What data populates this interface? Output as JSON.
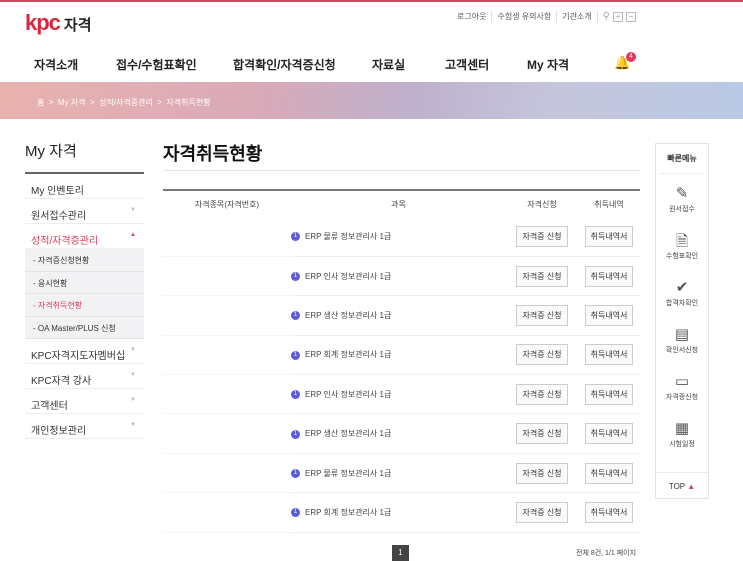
{
  "header": {
    "logo_mark": "kpc",
    "logo_text": "자격",
    "util": [
      "로그아웃",
      "수험생 유의사항",
      "기관소개"
    ],
    "nav": [
      "자격소개",
      "접수/수험표확인",
      "합격확인/자격증신청",
      "자료실",
      "고객센터",
      "My 자격"
    ],
    "notification_count": "4"
  },
  "breadcrumb": "홈  >  My 자격  >  성적/자격증관리  >  자격취득현황",
  "sidebar": {
    "title": "My 자격",
    "items": [
      {
        "label": "My 인벤토리"
      },
      {
        "label": "원서접수관리"
      },
      {
        "label": "성적/자격증관리"
      },
      {
        "label": "KPC자격지도자멤버십"
      },
      {
        "label": "KPC자격 강사"
      },
      {
        "label": "고객센터"
      },
      {
        "label": "개인정보관리"
      }
    ],
    "subitems": [
      "- 자격증신청현황",
      "- 응시현황",
      "- 자격취득현황",
      "- OA Master/PLUS 신청"
    ]
  },
  "main": {
    "title": "자격취득현황",
    "columns": [
      "자격종목(자격번호)",
      "과목",
      "자격신청",
      "취득내역"
    ],
    "rows": [
      {
        "num": "1",
        "subject": "ERP 물류 정보관리사 1급"
      },
      {
        "num": "1",
        "subject": "ERP 인사 정보관리사 1급"
      },
      {
        "num": "1",
        "subject": "ERP 생산 정보관리사 1급"
      },
      {
        "num": "1",
        "subject": "ERP 회계 정보관리사 1급"
      },
      {
        "num": "1",
        "subject": "ERP 인사 정보관리사 1급"
      },
      {
        "num": "1",
        "subject": "ERP 생산 정보관리사 1급"
      },
      {
        "num": "1",
        "subject": "ERP 물류 정보관리사 1급"
      },
      {
        "num": "1",
        "subject": "ERP 회계 정보관리사 1급"
      }
    ],
    "apply_label": "자격증 신청",
    "history_label": "취득내역서",
    "page": "1",
    "total": "전체 8건, 1/1 페이지"
  },
  "quick_menu": {
    "title": "빠른메뉴",
    "items": [
      "원서접수",
      "수험표확인",
      "합격자확인",
      "확인서신청",
      "자격증신청",
      "시험일정"
    ],
    "top": "TOP"
  }
}
